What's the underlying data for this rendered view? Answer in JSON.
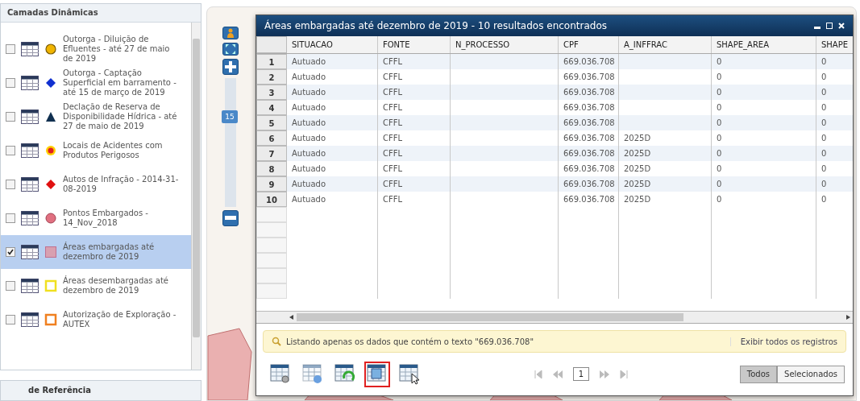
{
  "sidebar": {
    "title": "Camadas Dinâmicas",
    "layers": [
      {
        "label": "Outorga - Diluição de Efluentes - até 27 de maio de 2019",
        "checked": false,
        "selected": false,
        "kind": "circle-ring",
        "color": "#f0b400"
      },
      {
        "label": "Outorga - Captação Superficial em barramento - até 15 de março de 2019",
        "checked": false,
        "selected": false,
        "kind": "diamond",
        "color": "#1030d0"
      },
      {
        "label": "Declação de Reserva de Disponibilidade Hídrica - até 27 de maio de 2019",
        "checked": false,
        "selected": false,
        "kind": "triangle",
        "color": "#103050"
      },
      {
        "label": "Locais de Acidentes com Produtos Perigosos",
        "checked": false,
        "selected": false,
        "kind": "dot-ring",
        "color": "#e02020"
      },
      {
        "label": "Autos de Infração - 2014-31-08-2019",
        "checked": false,
        "selected": false,
        "kind": "diamond",
        "color": "#e01010"
      },
      {
        "label": "Pontos Embargados - 14_Nov_2018",
        "checked": false,
        "selected": false,
        "kind": "circle",
        "color": "#e07080"
      },
      {
        "label": "Áreas embargadas até dezembro de 2019",
        "checked": true,
        "selected": true,
        "kind": "square",
        "color": "#d8a0b0"
      },
      {
        "label": "Áreas desembargadas até dezembro de 2019",
        "checked": false,
        "selected": false,
        "kind": "square-outline",
        "color": "#f0e020"
      },
      {
        "label": "Autorização de Exploração - AUTEX",
        "checked": false,
        "selected": false,
        "kind": "square-outline",
        "color": "#f08020"
      }
    ],
    "next_panel": "de Referência"
  },
  "zoom": {
    "level": 0.7,
    "label": "15"
  },
  "window": {
    "title": "Áreas embargadas até dezembro de 2019 - 10 resultados encontrados",
    "table": {
      "columns": [
        "SITUACAO",
        "FONTE",
        "N_PROCESSO",
        "CPF",
        "A_INFFRAC",
        "SHAPE_AREA",
        "SHAPE"
      ],
      "rows": [
        {
          "num": "1",
          "cells": [
            "Autuado",
            "CFFL",
            "",
            "669.036.708",
            "",
            "0",
            "0"
          ]
        },
        {
          "num": "2",
          "cells": [
            "Autuado",
            "CFFL",
            "",
            "669.036.708",
            "",
            "0",
            "0"
          ]
        },
        {
          "num": "3",
          "cells": [
            "Autuado",
            "CFFL",
            "",
            "669.036.708",
            "",
            "0",
            "0"
          ]
        },
        {
          "num": "4",
          "cells": [
            "Autuado",
            "CFFL",
            "",
            "669.036.708",
            "",
            "0",
            "0"
          ]
        },
        {
          "num": "5",
          "cells": [
            "Autuado",
            "CFFL",
            "",
            "669.036.708",
            "",
            "0",
            "0"
          ]
        },
        {
          "num": "6",
          "cells": [
            "Autuado",
            "CFFL",
            "",
            "669.036.708",
            "2025D",
            "0",
            "0"
          ]
        },
        {
          "num": "7",
          "cells": [
            "Autuado",
            "CFFL",
            "",
            "669.036.708",
            "2025D",
            "0",
            "0"
          ]
        },
        {
          "num": "8",
          "cells": [
            "Autuado",
            "CFFL",
            "",
            "669.036.708",
            "2025D",
            "0",
            "0"
          ]
        },
        {
          "num": "9",
          "cells": [
            "Autuado",
            "CFFL",
            "",
            "669.036.708",
            "2025D",
            "0",
            "0"
          ]
        },
        {
          "num": "10",
          "cells": [
            "Autuado",
            "CFFL",
            "",
            "669.036.708",
            "2025D",
            "0",
            "0"
          ]
        }
      ]
    },
    "filter": {
      "text": "Listando apenas os dados que contém o texto \"669.036.708\"",
      "link": "Exibir todos os registros"
    },
    "tools": [
      {
        "kind": "settings",
        "highlighted": false
      },
      {
        "kind": "info",
        "highlighted": false
      },
      {
        "kind": "refresh",
        "highlighted": false
      },
      {
        "kind": "zoom-to",
        "highlighted": true
      },
      {
        "kind": "select",
        "highlighted": false
      }
    ],
    "page": "1",
    "modes": [
      {
        "label": "Todos",
        "selected": true
      },
      {
        "label": "Selecionados",
        "selected": false
      }
    ]
  }
}
